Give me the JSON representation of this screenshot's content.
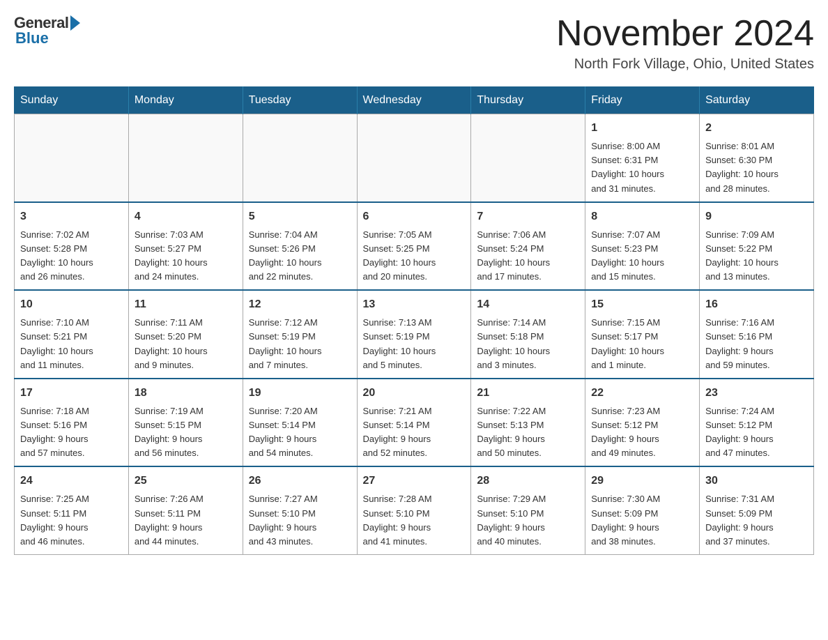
{
  "header": {
    "logo": {
      "general": "General",
      "blue": "Blue"
    },
    "title": "November 2024",
    "location": "North Fork Village, Ohio, United States"
  },
  "days_of_week": [
    "Sunday",
    "Monday",
    "Tuesday",
    "Wednesday",
    "Thursday",
    "Friday",
    "Saturday"
  ],
  "weeks": [
    {
      "days": [
        {
          "num": "",
          "info": ""
        },
        {
          "num": "",
          "info": ""
        },
        {
          "num": "",
          "info": ""
        },
        {
          "num": "",
          "info": ""
        },
        {
          "num": "",
          "info": ""
        },
        {
          "num": "1",
          "info": "Sunrise: 8:00 AM\nSunset: 6:31 PM\nDaylight: 10 hours\nand 31 minutes."
        },
        {
          "num": "2",
          "info": "Sunrise: 8:01 AM\nSunset: 6:30 PM\nDaylight: 10 hours\nand 28 minutes."
        }
      ]
    },
    {
      "days": [
        {
          "num": "3",
          "info": "Sunrise: 7:02 AM\nSunset: 5:28 PM\nDaylight: 10 hours\nand 26 minutes."
        },
        {
          "num": "4",
          "info": "Sunrise: 7:03 AM\nSunset: 5:27 PM\nDaylight: 10 hours\nand 24 minutes."
        },
        {
          "num": "5",
          "info": "Sunrise: 7:04 AM\nSunset: 5:26 PM\nDaylight: 10 hours\nand 22 minutes."
        },
        {
          "num": "6",
          "info": "Sunrise: 7:05 AM\nSunset: 5:25 PM\nDaylight: 10 hours\nand 20 minutes."
        },
        {
          "num": "7",
          "info": "Sunrise: 7:06 AM\nSunset: 5:24 PM\nDaylight: 10 hours\nand 17 minutes."
        },
        {
          "num": "8",
          "info": "Sunrise: 7:07 AM\nSunset: 5:23 PM\nDaylight: 10 hours\nand 15 minutes."
        },
        {
          "num": "9",
          "info": "Sunrise: 7:09 AM\nSunset: 5:22 PM\nDaylight: 10 hours\nand 13 minutes."
        }
      ]
    },
    {
      "days": [
        {
          "num": "10",
          "info": "Sunrise: 7:10 AM\nSunset: 5:21 PM\nDaylight: 10 hours\nand 11 minutes."
        },
        {
          "num": "11",
          "info": "Sunrise: 7:11 AM\nSunset: 5:20 PM\nDaylight: 10 hours\nand 9 minutes."
        },
        {
          "num": "12",
          "info": "Sunrise: 7:12 AM\nSunset: 5:19 PM\nDaylight: 10 hours\nand 7 minutes."
        },
        {
          "num": "13",
          "info": "Sunrise: 7:13 AM\nSunset: 5:19 PM\nDaylight: 10 hours\nand 5 minutes."
        },
        {
          "num": "14",
          "info": "Sunrise: 7:14 AM\nSunset: 5:18 PM\nDaylight: 10 hours\nand 3 minutes."
        },
        {
          "num": "15",
          "info": "Sunrise: 7:15 AM\nSunset: 5:17 PM\nDaylight: 10 hours\nand 1 minute."
        },
        {
          "num": "16",
          "info": "Sunrise: 7:16 AM\nSunset: 5:16 PM\nDaylight: 9 hours\nand 59 minutes."
        }
      ]
    },
    {
      "days": [
        {
          "num": "17",
          "info": "Sunrise: 7:18 AM\nSunset: 5:16 PM\nDaylight: 9 hours\nand 57 minutes."
        },
        {
          "num": "18",
          "info": "Sunrise: 7:19 AM\nSunset: 5:15 PM\nDaylight: 9 hours\nand 56 minutes."
        },
        {
          "num": "19",
          "info": "Sunrise: 7:20 AM\nSunset: 5:14 PM\nDaylight: 9 hours\nand 54 minutes."
        },
        {
          "num": "20",
          "info": "Sunrise: 7:21 AM\nSunset: 5:14 PM\nDaylight: 9 hours\nand 52 minutes."
        },
        {
          "num": "21",
          "info": "Sunrise: 7:22 AM\nSunset: 5:13 PM\nDaylight: 9 hours\nand 50 minutes."
        },
        {
          "num": "22",
          "info": "Sunrise: 7:23 AM\nSunset: 5:12 PM\nDaylight: 9 hours\nand 49 minutes."
        },
        {
          "num": "23",
          "info": "Sunrise: 7:24 AM\nSunset: 5:12 PM\nDaylight: 9 hours\nand 47 minutes."
        }
      ]
    },
    {
      "days": [
        {
          "num": "24",
          "info": "Sunrise: 7:25 AM\nSunset: 5:11 PM\nDaylight: 9 hours\nand 46 minutes."
        },
        {
          "num": "25",
          "info": "Sunrise: 7:26 AM\nSunset: 5:11 PM\nDaylight: 9 hours\nand 44 minutes."
        },
        {
          "num": "26",
          "info": "Sunrise: 7:27 AM\nSunset: 5:10 PM\nDaylight: 9 hours\nand 43 minutes."
        },
        {
          "num": "27",
          "info": "Sunrise: 7:28 AM\nSunset: 5:10 PM\nDaylight: 9 hours\nand 41 minutes."
        },
        {
          "num": "28",
          "info": "Sunrise: 7:29 AM\nSunset: 5:10 PM\nDaylight: 9 hours\nand 40 minutes."
        },
        {
          "num": "29",
          "info": "Sunrise: 7:30 AM\nSunset: 5:09 PM\nDaylight: 9 hours\nand 38 minutes."
        },
        {
          "num": "30",
          "info": "Sunrise: 7:31 AM\nSunset: 5:09 PM\nDaylight: 9 hours\nand 37 minutes."
        }
      ]
    }
  ]
}
